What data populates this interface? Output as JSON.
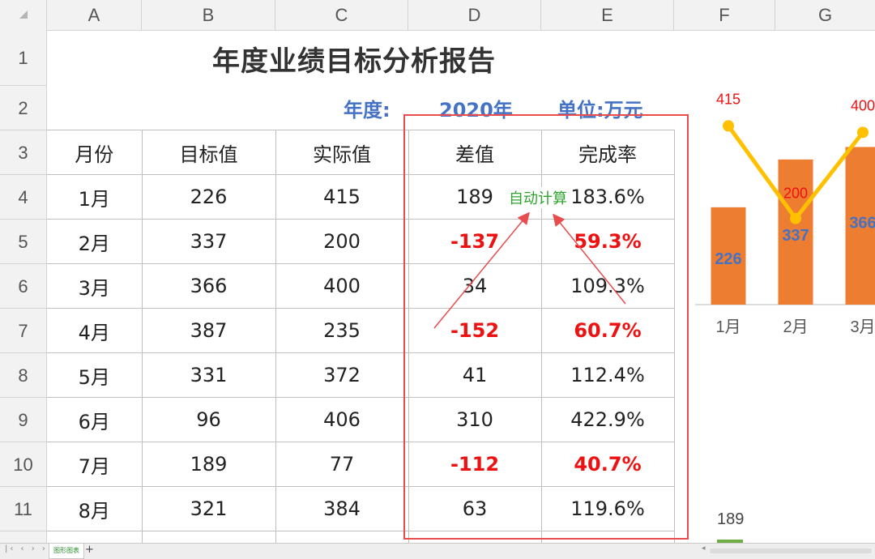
{
  "columns": [
    "A",
    "B",
    "C",
    "D",
    "E",
    "F",
    "G"
  ],
  "rows": [
    "1",
    "2",
    "3",
    "4",
    "5",
    "6",
    "7",
    "8",
    "9",
    "10",
    "11"
  ],
  "title": "年度业绩目标分析报告",
  "year_label": "年度:",
  "year_value": "2020年",
  "unit_label": "单位:万元",
  "table": {
    "headers": [
      "月份",
      "目标值",
      "实际值",
      "差值",
      "完成率"
    ],
    "rows": [
      {
        "month": "1月",
        "target": "226",
        "actual": "415",
        "diff": "189",
        "rate": "183.6%",
        "neg": false
      },
      {
        "month": "2月",
        "target": "337",
        "actual": "200",
        "diff": "-137",
        "rate": "59.3%",
        "neg": true
      },
      {
        "month": "3月",
        "target": "366",
        "actual": "400",
        "diff": "34",
        "rate": "109.3%",
        "neg": false
      },
      {
        "month": "4月",
        "target": "387",
        "actual": "235",
        "diff": "-152",
        "rate": "60.7%",
        "neg": true
      },
      {
        "month": "5月",
        "target": "331",
        "actual": "372",
        "diff": "41",
        "rate": "112.4%",
        "neg": false
      },
      {
        "month": "6月",
        "target": "96",
        "actual": "406",
        "diff": "310",
        "rate": "422.9%",
        "neg": false
      },
      {
        "month": "7月",
        "target": "189",
        "actual": "77",
        "diff": "-112",
        "rate": "40.7%",
        "neg": true
      },
      {
        "month": "8月",
        "target": "321",
        "actual": "384",
        "diff": "63",
        "rate": "119.6%",
        "neg": false
      }
    ]
  },
  "annotation": "自动计算",
  "colors": {
    "accent": "#4472c4",
    "negative": "#ee1111",
    "bar": "#ed7d31",
    "line": "#ffc000",
    "box": "#e84c4c",
    "note": "#2ea32e",
    "diffbar": "#70ad47"
  },
  "chart_data": {
    "type": "bar",
    "categories": [
      "1月",
      "2月",
      "3月"
    ],
    "series": [
      {
        "values": [
          226,
          337,
          366
        ]
      },
      {
        "values": [
          415,
          200,
          400
        ]
      }
    ],
    "bar_labels": [
      "226",
      "337",
      "366"
    ],
    "line_labels": [
      "415",
      "200",
      "400"
    ],
    "diff_label": "189"
  },
  "sheet_tab": "图形图表",
  "add_sheet": "+"
}
